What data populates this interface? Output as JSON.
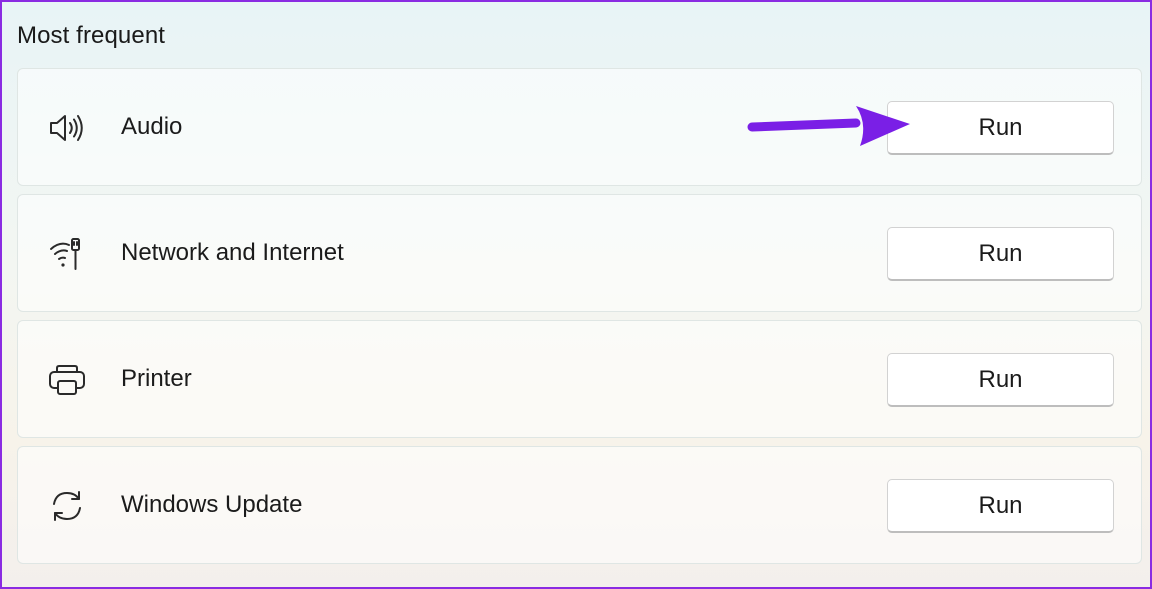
{
  "section": {
    "title": "Most frequent"
  },
  "items": [
    {
      "label": "Audio",
      "icon": "speaker-icon",
      "button_label": "Run"
    },
    {
      "label": "Network and Internet",
      "icon": "network-icon",
      "button_label": "Run"
    },
    {
      "label": "Printer",
      "icon": "printer-icon",
      "button_label": "Run"
    },
    {
      "label": "Windows Update",
      "icon": "refresh-icon",
      "button_label": "Run"
    }
  ],
  "annotation": {
    "arrow_color": "#7a1fe6",
    "points_to": "Audio Run button"
  },
  "colors": {
    "frame_border": "#8a2be2",
    "card_border": "#dfe6e4",
    "button_bg": "#ffffff"
  }
}
